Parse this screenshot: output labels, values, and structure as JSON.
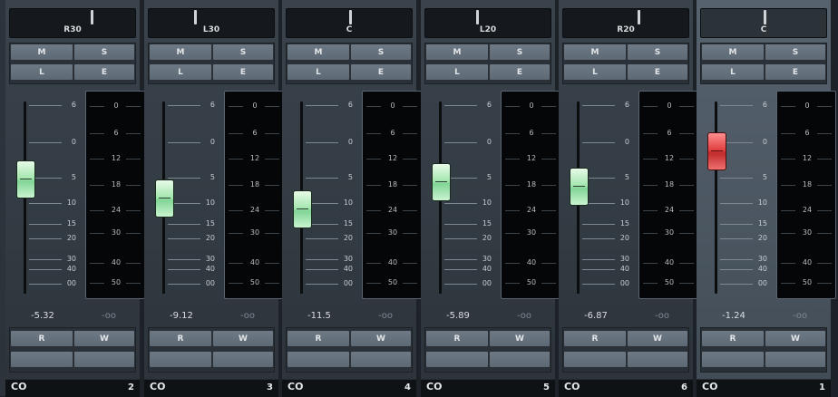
{
  "colors": {
    "strip": "#3a434c",
    "selected_strip": "#56626e",
    "fader_green": "#a7e7b1",
    "fader_red": "#e24242",
    "meter_bg": "#050607"
  },
  "icons": {
    "link": "link-icon"
  },
  "fader_scale": [
    "6",
    "0",
    "5",
    "10",
    "15",
    "20",
    "30",
    "40",
    "00"
  ],
  "meter_scale": [
    "0",
    "6",
    "12",
    "18",
    "24",
    "30",
    "40",
    "50"
  ],
  "strips": [
    {
      "pan_label": "R30",
      "pan": 0.65,
      "mute": "M",
      "solo": "S",
      "listen": "L",
      "edit": "E",
      "volume": "-5.32",
      "peak": "-oo",
      "read": "R",
      "write": "W",
      "number": "2",
      "link_icon": "CO",
      "selected": false
    },
    {
      "pan_label": "L30",
      "pan": 0.35,
      "mute": "M",
      "solo": "S",
      "listen": "L",
      "edit": "E",
      "volume": "-9.12",
      "peak": "-oo",
      "read": "R",
      "write": "W",
      "number": "3",
      "link_icon": "CO",
      "selected": false
    },
    {
      "pan_label": "C",
      "pan": 0.5,
      "mute": "M",
      "solo": "S",
      "listen": "L",
      "edit": "E",
      "volume": "-11.5",
      "peak": "-oo",
      "read": "R",
      "write": "W",
      "number": "4",
      "link_icon": "CO",
      "selected": false
    },
    {
      "pan_label": "L20",
      "pan": 0.4,
      "mute": "M",
      "solo": "S",
      "listen": "L",
      "edit": "E",
      "volume": "-5.89",
      "peak": "-oo",
      "read": "R",
      "write": "W",
      "number": "5",
      "link_icon": "CO",
      "selected": false
    },
    {
      "pan_label": "R20",
      "pan": 0.6,
      "mute": "M",
      "solo": "S",
      "listen": "L",
      "edit": "E",
      "volume": "-6.87",
      "peak": "-oo",
      "read": "R",
      "write": "W",
      "number": "6",
      "link_icon": "CO",
      "selected": false
    },
    {
      "pan_label": "C",
      "pan": 0.5,
      "mute": "M",
      "solo": "S",
      "listen": "L",
      "edit": "E",
      "volume": "-1.24",
      "peak": "-oo",
      "read": "R",
      "write": "W",
      "number": "1",
      "link_icon": "CO",
      "selected": true
    }
  ]
}
